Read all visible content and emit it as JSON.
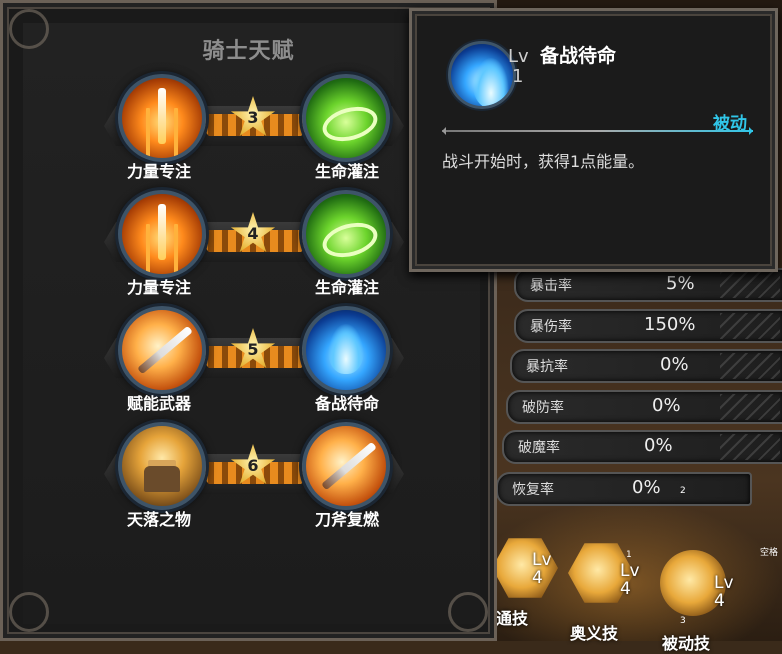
{
  "talent_panel": {
    "title": "骑士天赋",
    "rows": [
      {
        "rank": "3",
        "left_name": "力量专注",
        "left_icon": "sword-burst-icon",
        "right_name": "生命灌注",
        "right_icon": "life-swirl-icon"
      },
      {
        "rank": "4",
        "left_name": "力量专注",
        "left_icon": "sword-burst-icon",
        "right_name": "生命灌注",
        "right_icon": "life-swirl-icon"
      },
      {
        "rank": "5",
        "left_name": "赋能武器",
        "left_icon": "empowered-weapon-icon",
        "right_name": "备战待命",
        "right_icon": "blue-flame-icon"
      },
      {
        "rank": "6",
        "left_name": "天落之物",
        "left_icon": "falling-object-icon",
        "right_name": "刀斧复燃",
        "right_icon": "empowered-weapon-icon"
      }
    ]
  },
  "tooltip": {
    "icon": "blue-flame-icon",
    "lv_label": "Lv",
    "lv_value": "1",
    "name": "备战待命",
    "type": "被动",
    "description": "战斗开始时，获得1点能量。"
  },
  "stats": [
    {
      "label": "暴击率",
      "value": "5%"
    },
    {
      "label": "暴伤率",
      "value": "150%"
    },
    {
      "label": "暴抗率",
      "value": "0%"
    },
    {
      "label": "破防率",
      "value": "0%"
    },
    {
      "label": "破魔率",
      "value": "0%"
    },
    {
      "label": "恢复率",
      "value": "0%"
    }
  ],
  "stat_marker": "2",
  "skills": [
    {
      "lv_label": "Lv",
      "lv_value": "4",
      "name": "通技",
      "badge": ""
    },
    {
      "lv_label": "Lv",
      "lv_value": "4",
      "name": "奥义技",
      "badge": "1"
    },
    {
      "lv_label": "Lv",
      "lv_value": "4",
      "name": "被动技",
      "badge": "3"
    }
  ],
  "corner_hint": "空格",
  "colors": {
    "accent_cyan": "#30c6e8",
    "star_gold": "#e9b73c",
    "chevron_orange": "#e88b1e",
    "panel_border": "#6b6157"
  }
}
